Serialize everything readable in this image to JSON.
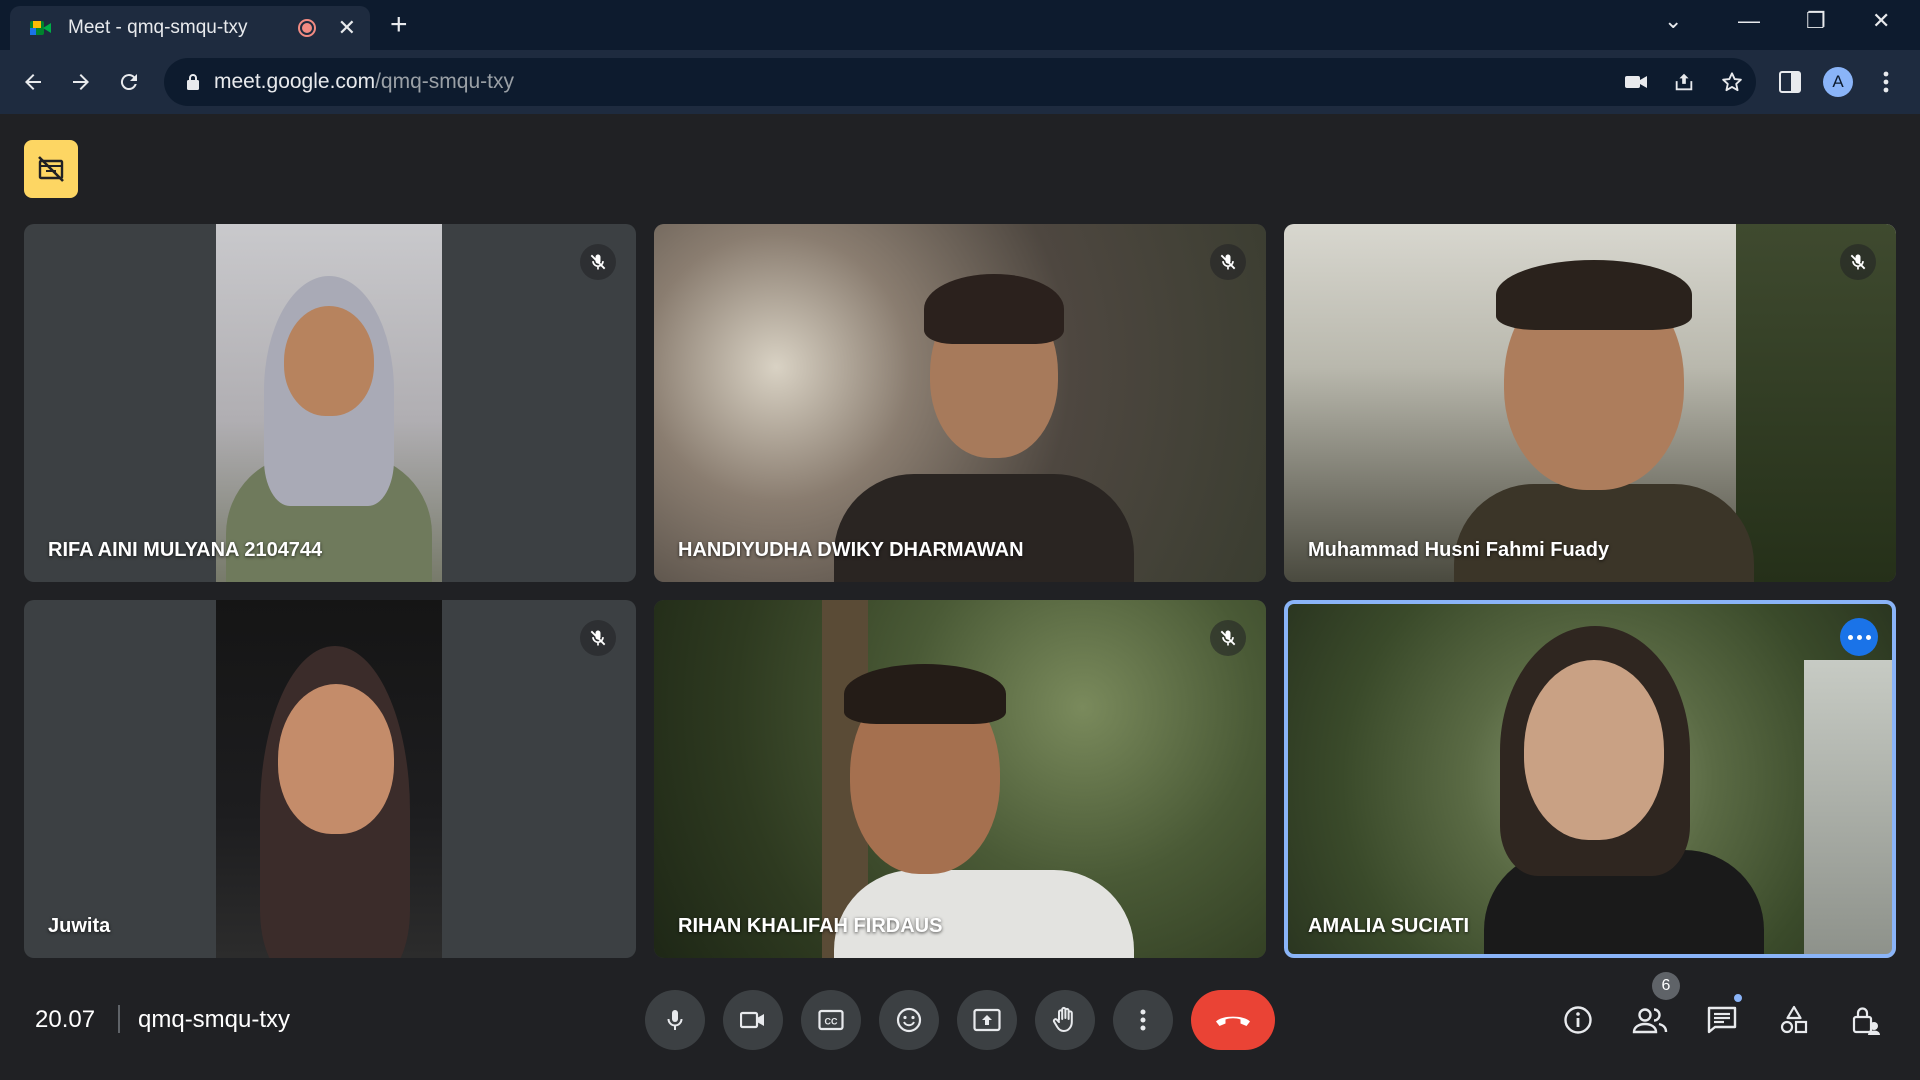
{
  "browser": {
    "tab_title": "Meet - qmq-smqu-txy",
    "tab_close": "✕",
    "new_tab": "+",
    "url_host": "meet.google.com",
    "url_path": "/qmq-smqu-txy",
    "avatar_letter": "A",
    "window_controls": {
      "dropdown": "⌄",
      "minimize": "—",
      "restore": "❐",
      "close": "✕"
    }
  },
  "tiles": [
    {
      "name": "RIFA AINI MULYANA 2104744",
      "muted": true
    },
    {
      "name": "HANDIYUDHA DWIKY DHARMAWAN",
      "muted": true
    },
    {
      "name": "Muhammad Husni Fahmi Fuady",
      "muted": true
    },
    {
      "name": "Juwita",
      "muted": true
    },
    {
      "name": "RIHAN KHALIFAH FIRDAUS",
      "muted": true
    },
    {
      "name": "AMALIA SUCIATI",
      "muted": false
    }
  ],
  "footer": {
    "time": "20.07",
    "meeting_code": "qmq-smqu-txy",
    "people_count": "6"
  },
  "colors": {
    "end_call": "#ea4335",
    "accent": "#1a73e8",
    "active_border": "#8ab4f8",
    "notice": "#fdd663"
  }
}
